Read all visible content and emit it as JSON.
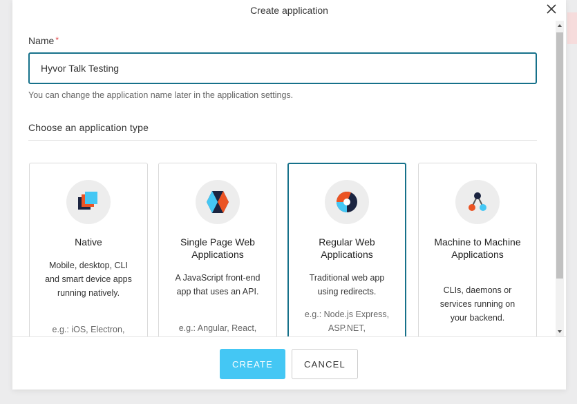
{
  "dialog": {
    "title": "Create application"
  },
  "name_field": {
    "label": "Name",
    "required_mark": "*",
    "value": "Hyvor Talk Testing",
    "helper": "You can change the application name later in the application settings."
  },
  "app_type": {
    "section_title": "Choose an application type",
    "cards": [
      {
        "title": "Native",
        "description": "Mobile, desktop, CLI and smart device apps running natively.",
        "example": "e.g.: iOS, Electron,",
        "icon": "native-app-icon",
        "selected": false
      },
      {
        "title": "Single Page Web Applications",
        "description": "A JavaScript front-end app that uses an API.",
        "example": "e.g.: Angular, React,",
        "icon": "spa-icon",
        "selected": false
      },
      {
        "title": "Regular Web Applications",
        "description": "Traditional web app using redirects.",
        "example": "e.g.: Node.js Express, ASP.NET,",
        "icon": "regular-web-app-icon",
        "selected": true
      },
      {
        "title": "Machine to Machine Applications",
        "description": "CLIs, daemons or services running on your backend.",
        "example": "",
        "icon": "machine-to-machine-icon",
        "selected": false
      }
    ]
  },
  "footer": {
    "create_label": "CREATE",
    "cancel_label": "CANCEL"
  },
  "colors": {
    "accent": "#16718a",
    "primary_button": "#44c7f4",
    "required": "#e0494c"
  }
}
